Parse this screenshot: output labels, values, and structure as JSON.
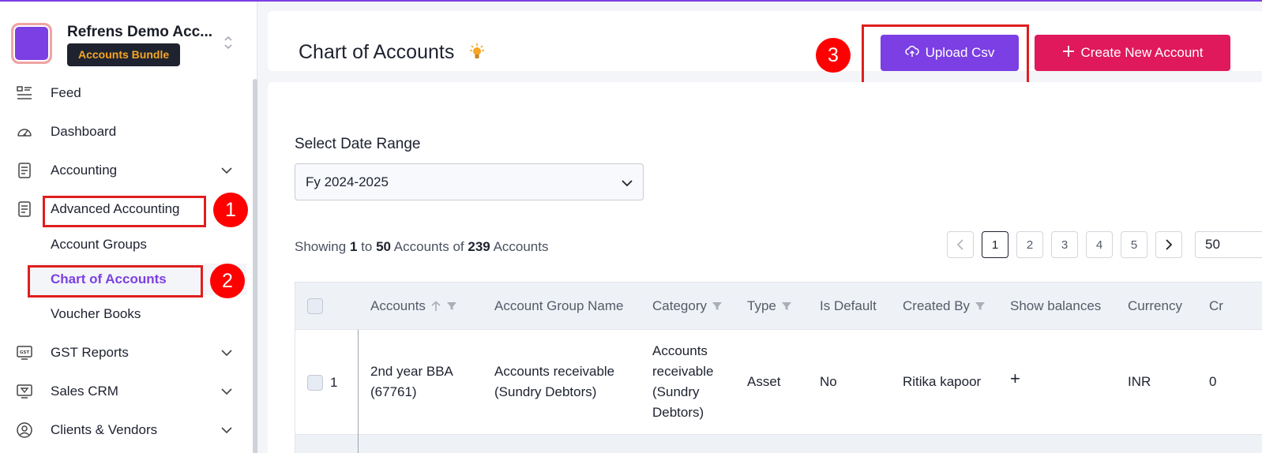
{
  "org": {
    "name": "Refrens Demo Acc...",
    "badge": "Accounts Bundle"
  },
  "sidebar": {
    "items": [
      {
        "label": "Feed",
        "icon": "feed-icon"
      },
      {
        "label": "Dashboard",
        "icon": "dashboard-gauge-icon"
      },
      {
        "label": "Accounting",
        "icon": "document-icon"
      },
      {
        "label": "Advanced Accounting",
        "icon": "document-icon"
      },
      {
        "label": "GST Reports",
        "icon": "gst-icon"
      },
      {
        "label": "Sales CRM",
        "icon": "crm-funnel-icon"
      },
      {
        "label": "Clients & Vendors",
        "icon": "user-circle-icon"
      }
    ],
    "subitems": [
      {
        "label": "Account Groups"
      },
      {
        "label": "Chart of Accounts",
        "active": true
      },
      {
        "label": "Voucher Books"
      }
    ]
  },
  "callouts": [
    "1",
    "2",
    "3"
  ],
  "header": {
    "title": "Chart of Accounts",
    "upload_label": "Upload Csv",
    "create_label": "Create New Account"
  },
  "filters": {
    "date_label": "Select Date Range",
    "date_value": "Fy 2024-2025"
  },
  "summary": {
    "prefix": "Showing",
    "from": "1",
    "to_word": "to",
    "to": "50",
    "unit1": "Accounts",
    "of_word": "of",
    "total": "239",
    "unit2": "Accounts"
  },
  "pagination": {
    "pages": [
      "1",
      "2",
      "3",
      "4",
      "5"
    ],
    "current": "1",
    "page_size": "50"
  },
  "table": {
    "columns": [
      "Accounts",
      "Account Group Name",
      "Category",
      "Type",
      "Is Default",
      "Created By",
      "Show balances",
      "Currency",
      "Cr"
    ],
    "rows": [
      {
        "index": "1",
        "account_line1": "2nd year BBA",
        "account_line2": "(67761)",
        "group_line1": "Accounts receivable",
        "group_line2": "(Sundry Debtors)",
        "category_line1": "Accounts",
        "category_line2": "receivable",
        "category_line3": "(Sundry",
        "category_line4": "Debtors)",
        "type": "Asset",
        "is_default": "No",
        "created_by": "Ritika kapoor",
        "show_balances": "+",
        "currency": "INR",
        "cr": "0"
      }
    ]
  },
  "colors": {
    "accent": "#7b3fe4",
    "create": "#e0195c",
    "callout": "#ff0000"
  }
}
